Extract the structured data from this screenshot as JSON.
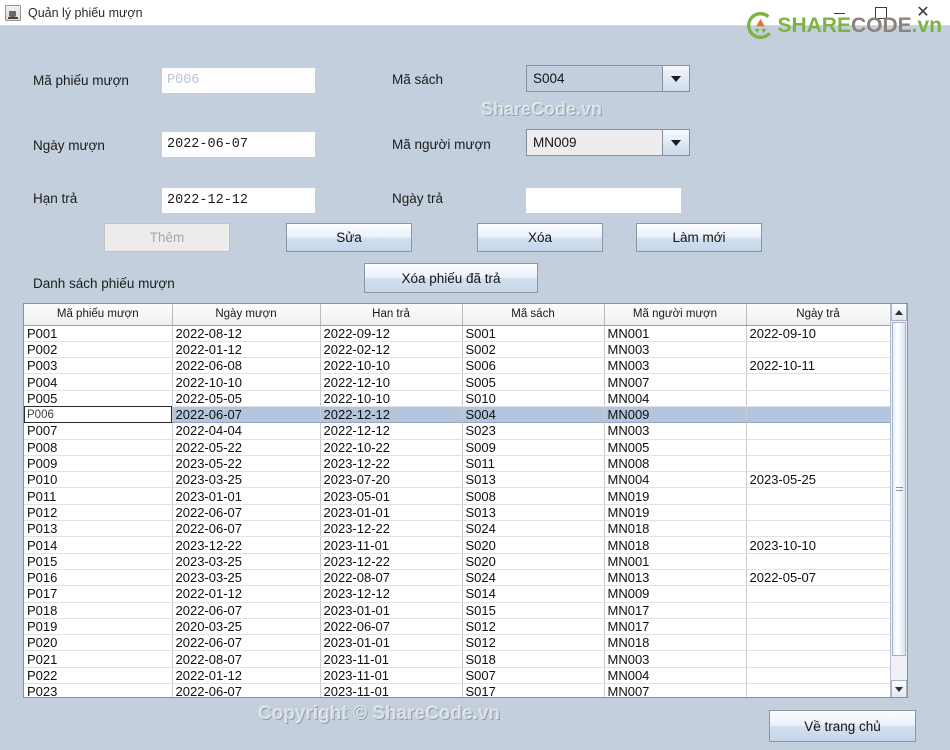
{
  "window": {
    "title": "Quản lý phiếu mượn",
    "icon": "java-cup-icon",
    "minimize": "minimize-icon",
    "maximize": "maximize-icon",
    "close": "close-icon"
  },
  "brand": {
    "share": "SHARE",
    "code": "CODE",
    "vn": ".vn",
    "mark_color": "#7cb342",
    "code_color": "#8d8277"
  },
  "watermarks": {
    "form": "ShareCode.vn",
    "footer": "Copyright © ShareCode.vn"
  },
  "form": {
    "ma_phieu_muon_label": "Mã phiếu mượn",
    "ma_phieu_muon_value": "P006",
    "ngay_muon_label": "Ngày mượn",
    "ngay_muon_value": "2022-06-07",
    "han_tra_label": "Hạn trả",
    "han_tra_value": "2022-12-12",
    "ma_sach_label": "Mã sách",
    "ma_sach_value": "S004",
    "ma_nguoi_muon_label": "Mã người mượn",
    "ma_nguoi_muon_value": "MN009",
    "ngay_tra_label": "Ngày trả",
    "ngay_tra_value": ""
  },
  "buttons": {
    "them": "Thêm",
    "sua": "Sửa",
    "xoa": "Xóa",
    "lam_moi": "Làm mới",
    "xoa_phieu_da_tra": "Xóa phiếu đã trả",
    "ve_trang_chu": "Về trang chủ"
  },
  "list": {
    "label": "Danh sách phiếu mượn",
    "columns": [
      "Mã phiếu mượn",
      "Ngày mượn",
      "Han trả",
      "Mã sách",
      "Mã người mượn",
      "Ngày trả"
    ],
    "selected_index": 5,
    "rows": [
      [
        "P001",
        "2022-08-12",
        "2022-09-12",
        "S001",
        "MN001",
        "2022-09-10"
      ],
      [
        "P002",
        "2022-01-12",
        "2022-02-12",
        "S002",
        "MN003",
        ""
      ],
      [
        "P003",
        "2022-06-08",
        "2022-10-10",
        "S006",
        "MN003",
        "2022-10-11"
      ],
      [
        "P004",
        "2022-10-10",
        "2022-12-10",
        "S005",
        "MN007",
        ""
      ],
      [
        "P005",
        "2022-05-05",
        "2022-10-10",
        "S010",
        "MN004",
        ""
      ],
      [
        "P006",
        "2022-06-07",
        "2022-12-12",
        "S004",
        "MN009",
        ""
      ],
      [
        "P007",
        "2022-04-04",
        "2022-12-12",
        "S023",
        "MN003",
        ""
      ],
      [
        "P008",
        "2022-05-22",
        "2022-10-22",
        "S009",
        "MN005",
        ""
      ],
      [
        "P009",
        "2023-05-22",
        "2023-12-22",
        "S011",
        "MN008",
        ""
      ],
      [
        "P010",
        "2023-03-25",
        "2023-07-20",
        "S013",
        "MN004",
        "2023-05-25"
      ],
      [
        "P011",
        "2023-01-01",
        "2023-05-01",
        "S008",
        "MN019",
        ""
      ],
      [
        "P012",
        "2022-06-07",
        "2023-01-01",
        "S013",
        "MN019",
        ""
      ],
      [
        "P013",
        "2022-06-07",
        "2023-12-22",
        "S024",
        "MN018",
        ""
      ],
      [
        "P014",
        "2023-12-22",
        "2023-11-01",
        "S020",
        "MN018",
        "2023-10-10"
      ],
      [
        "P015",
        "2023-03-25",
        "2023-12-22",
        "S020",
        "MN001",
        ""
      ],
      [
        "P016",
        "2023-03-25",
        "2022-08-07",
        "S024",
        "MN013",
        "2022-05-07"
      ],
      [
        "P017",
        "2022-01-12",
        "2023-12-12",
        "S014",
        "MN009",
        ""
      ],
      [
        "P018",
        "2022-06-07",
        "2023-01-01",
        "S015",
        "MN017",
        ""
      ],
      [
        "P019",
        "2020-03-25",
        "2022-06-07",
        "S012",
        "MN017",
        ""
      ],
      [
        "P020",
        "2022-06-07",
        "2023-01-01",
        "S012",
        "MN018",
        ""
      ],
      [
        "P021",
        "2022-08-07",
        "2023-11-01",
        "S018",
        "MN003",
        ""
      ],
      [
        "P022",
        "2022-01-12",
        "2023-11-01",
        "S007",
        "MN004",
        ""
      ],
      [
        "P023",
        "2022-06-07",
        "2023-11-01",
        "S017",
        "MN007",
        ""
      ]
    ]
  },
  "scrollbar": {
    "up": "scroll-up-icon",
    "down": "scroll-down-icon"
  }
}
